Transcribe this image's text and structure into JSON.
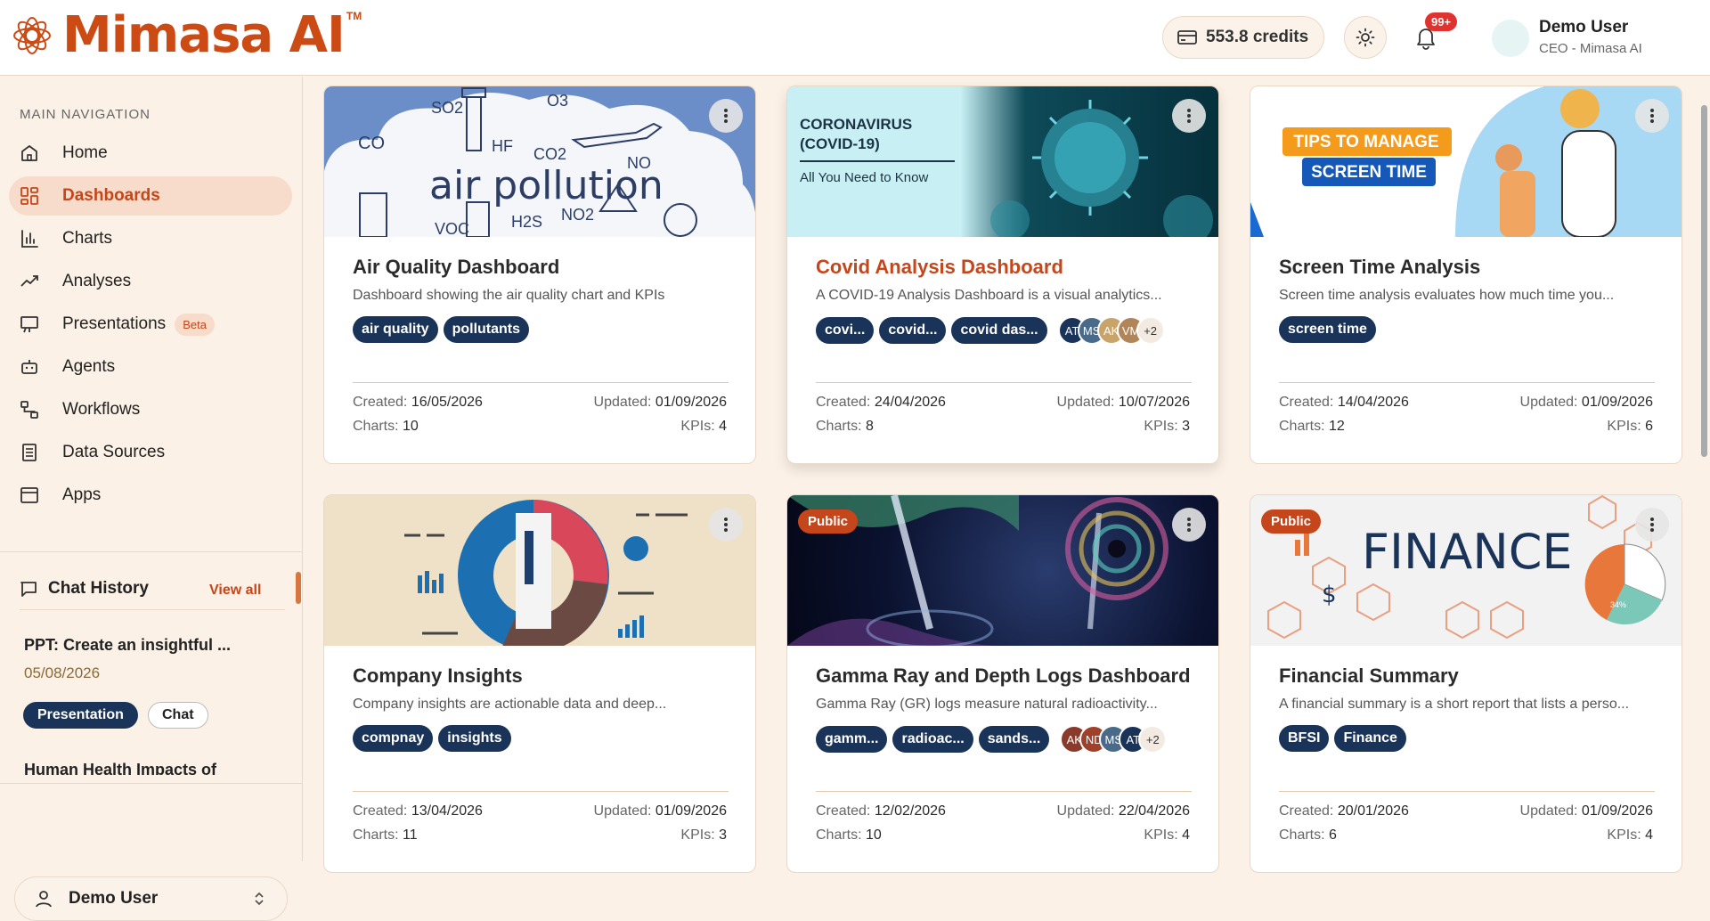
{
  "brand": {
    "name": "Mimasa AI",
    "tm": "TM"
  },
  "header": {
    "credits": "553.8 credits",
    "notifications": "99+",
    "user_name": "Demo User",
    "user_role": "CEO - Mimasa AI"
  },
  "sidebar": {
    "section_title": "MAIN NAVIGATION",
    "items": [
      {
        "label": "Home",
        "icon": "home-icon"
      },
      {
        "label": "Dashboards",
        "icon": "grid-icon",
        "active": true
      },
      {
        "label": "Charts",
        "icon": "bar-chart-icon"
      },
      {
        "label": "Analyses",
        "icon": "trend-icon"
      },
      {
        "label": "Presentations",
        "icon": "presentation-icon",
        "badge": "Beta"
      },
      {
        "label": "Agents",
        "icon": "bot-icon"
      },
      {
        "label": "Workflows",
        "icon": "workflow-icon"
      },
      {
        "label": "Data Sources",
        "icon": "database-icon"
      },
      {
        "label": "Apps",
        "icon": "app-window-icon"
      }
    ],
    "chat_history": {
      "title": "Chat History",
      "view_all": "View all",
      "items": [
        {
          "title": "PPT: Create an insightful ...",
          "date": "05/08/2026",
          "tags": [
            "Presentation",
            "Chat"
          ]
        },
        {
          "title": "Human Health Impacts of"
        }
      ]
    },
    "footer_user": "Demo User"
  },
  "labels": {
    "created": "Created:",
    "updated": "Updated:",
    "charts": "Charts:",
    "kpis": "KPIs:"
  },
  "cards": [
    {
      "title": "Air Quality Dashboard",
      "desc": "Dashboard showing the air quality chart and KPIs",
      "tags": [
        "air quality",
        "pollutants"
      ],
      "created": "16/05/2026",
      "updated": "01/09/2026",
      "charts": "10",
      "kpis": "4",
      "image_text": {
        "main": "air pollution",
        "chem": [
          "SO2",
          "O3",
          "CO",
          "HF",
          "CO2",
          "NO",
          "H2S",
          "NO2",
          "VOC"
        ]
      }
    },
    {
      "title": "Covid Analysis Dashboard",
      "desc": "A COVID-19 Analysis Dashboard is a visual analytics...",
      "tags": [
        "covi...",
        "covid...",
        "covid das..."
      ],
      "avatars": [
        "AT",
        "MS",
        "AK",
        "VM"
      ],
      "more": "+2",
      "created": "24/04/2026",
      "updated": "10/07/2026",
      "charts": "8",
      "kpis": "3",
      "image_text": {
        "line1": "CORONAVIRUS",
        "line2": "(COVID-19)",
        "sub": "All You Need to Know"
      }
    },
    {
      "title": "Screen Time Analysis",
      "desc": "Screen time analysis evaluates how much time you...",
      "tags": [
        "screen time"
      ],
      "created": "14/04/2026",
      "updated": "01/09/2026",
      "charts": "12",
      "kpis": "6",
      "image_text": {
        "line1": "TIPS TO MANAGE",
        "line2": "SCREEN TIME"
      }
    },
    {
      "title": "Company Insights",
      "desc": "Company insights are actionable data and deep...",
      "tags": [
        "compnay",
        "insights"
      ],
      "created": "13/04/2026",
      "updated": "01/09/2026",
      "charts": "11",
      "kpis": "3"
    },
    {
      "title": "Gamma Ray and Depth Logs Dashboard",
      "desc": "Gamma Ray (GR) logs measure natural radioactivity...",
      "tags": [
        "gamm...",
        "radioac...",
        "sands..."
      ],
      "avatars": [
        "AK",
        "ND",
        "MS",
        "AT"
      ],
      "more": "+2",
      "public": "Public",
      "created": "12/02/2026",
      "updated": "22/04/2026",
      "charts": "10",
      "kpis": "4"
    },
    {
      "title": "Financial Summary",
      "desc": "A financial summary is a short report that lists a perso...",
      "tags": [
        "BFSI",
        "Finance"
      ],
      "public": "Public",
      "created": "20/01/2026",
      "updated": "01/09/2026",
      "charts": "6",
      "kpis": "4",
      "image_text": {
        "main": "FINANCE",
        "pct": "34%"
      }
    }
  ],
  "colors": {
    "accent": "#c4461a",
    "tag_bg": "#1a3358",
    "page_bg": "#fbf1e6"
  }
}
